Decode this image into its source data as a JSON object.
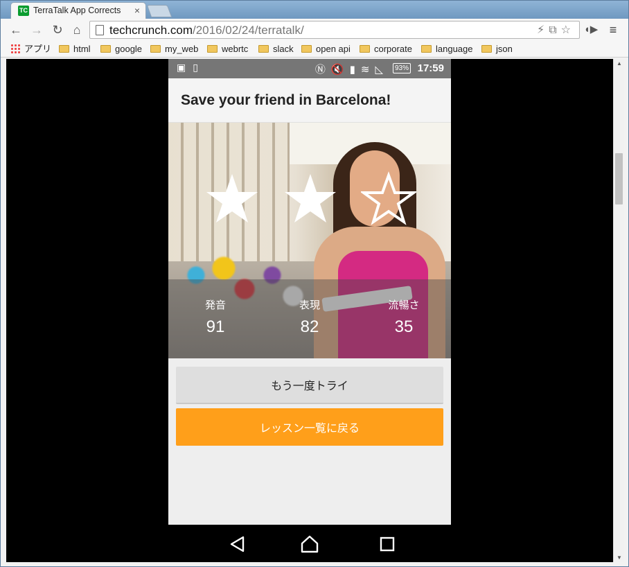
{
  "browser": {
    "tab_title": "TerraTalk App Corrects",
    "tab_favicon_text": "TC",
    "url_host": "techcrunch.com",
    "url_path": "/2016/02/24/terratalk/"
  },
  "bookmarks": [
    {
      "label": "アプリ",
      "icon": "apps-grid-icon"
    },
    {
      "label": "html",
      "icon": "folder-icon"
    },
    {
      "label": "google",
      "icon": "folder-icon"
    },
    {
      "label": "my_web",
      "icon": "folder-icon"
    },
    {
      "label": "webrtc",
      "icon": "folder-icon"
    },
    {
      "label": "slack",
      "icon": "folder-icon"
    },
    {
      "label": "open api",
      "icon": "folder-icon"
    },
    {
      "label": "corporate",
      "icon": "folder-icon"
    },
    {
      "label": "language",
      "icon": "folder-icon"
    },
    {
      "label": "json",
      "icon": "folder-icon"
    }
  ],
  "phone": {
    "status": {
      "battery": "93%",
      "time": "17:59"
    },
    "app_title": "Save your friend in Barcelona!",
    "stars": {
      "earned": 2,
      "total": 3
    },
    "scores": [
      {
        "label": "発音",
        "value": "91"
      },
      {
        "label": "表現",
        "value": "82"
      },
      {
        "label": "流暢さ",
        "value": "35"
      }
    ],
    "retry_label": "もう一度トライ",
    "back_label": "レッスン一覧に戻る",
    "colors": {
      "accent": "#ff9f1a",
      "statusbar": "#767676"
    }
  }
}
